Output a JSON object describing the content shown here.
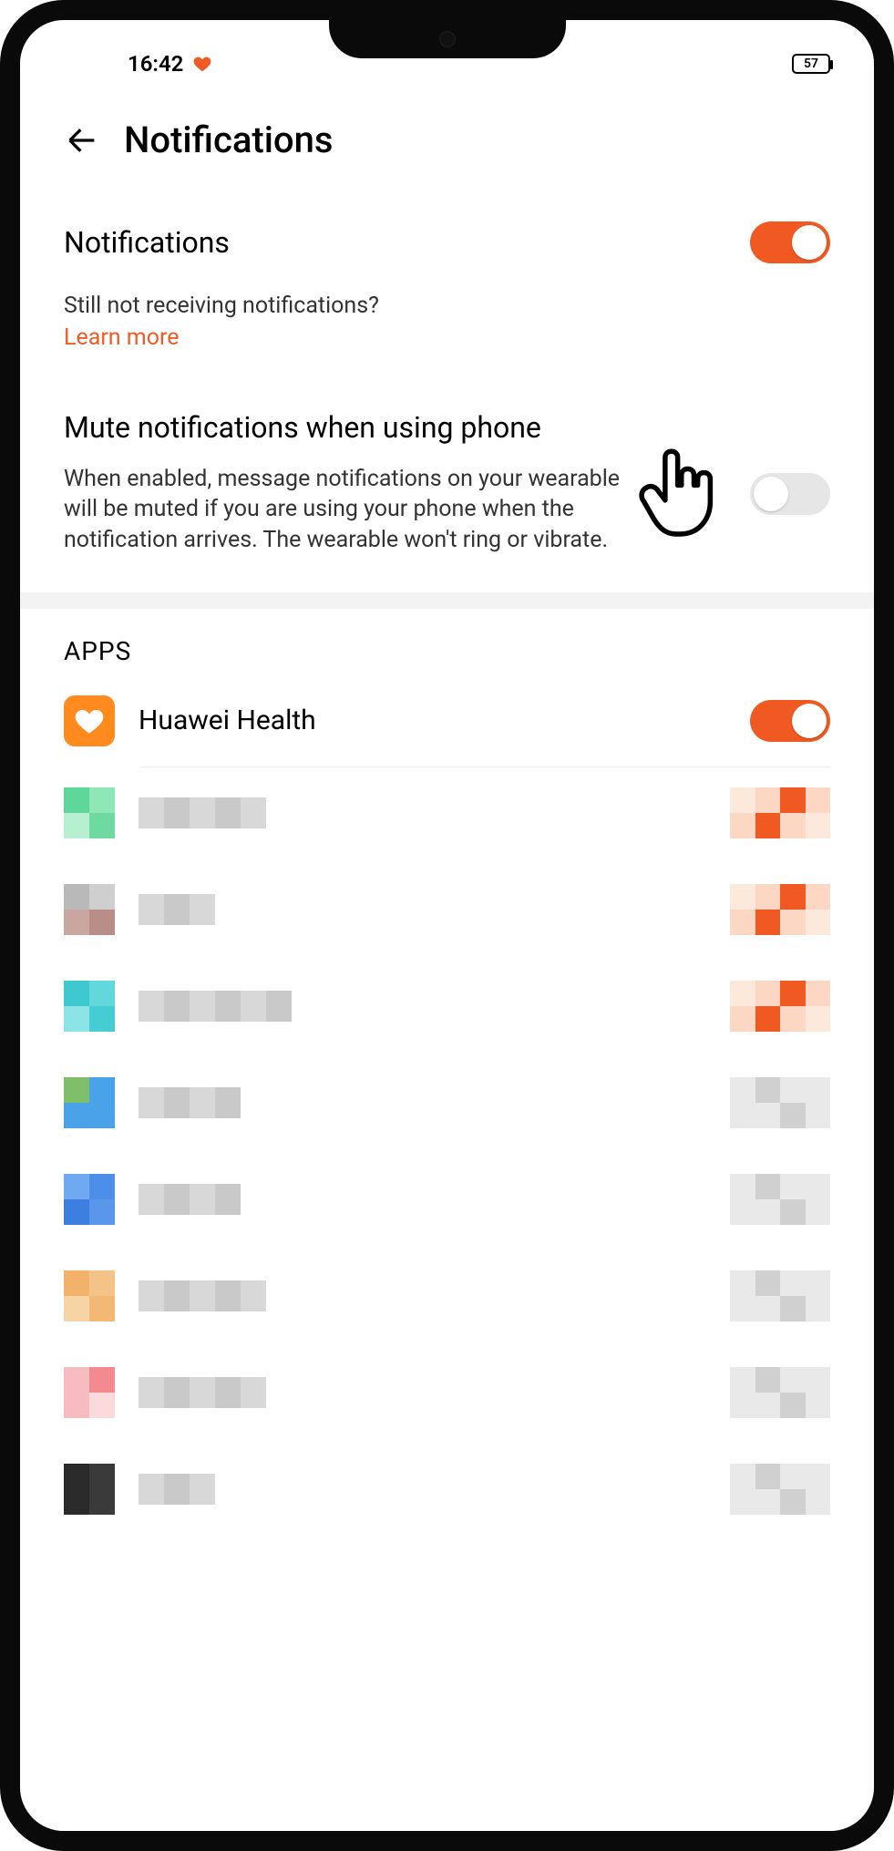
{
  "status": {
    "time": "16:42",
    "battery": "57"
  },
  "header": {
    "title": "Notifications"
  },
  "notifications": {
    "title": "Notifications",
    "enabled": true,
    "help_text": "Still not receiving notifications?",
    "learn_more": "Learn more"
  },
  "mute": {
    "title": "Mute notifications when using phone",
    "description": "When enabled, message notifications on your wearable will be muted if you are using your phone when the notification arrives. The wearable won't ring or vibrate.",
    "enabled": false
  },
  "apps": {
    "header": "APPS",
    "items": [
      {
        "name": "Huawei Health",
        "enabled": true,
        "icon": "health"
      }
    ],
    "blurred": [
      {
        "icon_colors": [
          "#5fd79a",
          "#8fe7b8",
          "#b7f0d0",
          "#6ed9a0"
        ],
        "text_segments": 5,
        "toggle": "on"
      },
      {
        "icon_colors": [
          "#b9b9b9",
          "#cfcfcf",
          "#caa6a0",
          "#b98e88"
        ],
        "text_segments": 3,
        "toggle": "on"
      },
      {
        "icon_colors": [
          "#3ec8cf",
          "#62d7dc",
          "#8de4e7",
          "#46cdd3"
        ],
        "text_segments": 6,
        "toggle": "on"
      },
      {
        "icon_colors": [
          "#7fbf6a",
          "#4aa2e8",
          "#4aa2e8",
          "#4aa2e8"
        ],
        "text_segments": 4,
        "toggle": "off"
      },
      {
        "icon_colors": [
          "#6fa9f2",
          "#4c8ee8",
          "#3c7fe0",
          "#5a97ea"
        ],
        "text_segments": 4,
        "toggle": "off"
      },
      {
        "icon_colors": [
          "#f2b26a",
          "#f4c388",
          "#f6d4a6",
          "#f3b874"
        ],
        "text_segments": 5,
        "toggle": "off"
      },
      {
        "icon_colors": [
          "#f7bcbf",
          "#f28a8f",
          "#f7bcbf",
          "#fadadc"
        ],
        "text_segments": 5,
        "toggle": "off"
      },
      {
        "icon_colors": [
          "#2a2a2a",
          "#3a3a3a",
          "#2a2a2a",
          "#3a3a3a"
        ],
        "text_segments": 3,
        "toggle": "off"
      }
    ]
  }
}
